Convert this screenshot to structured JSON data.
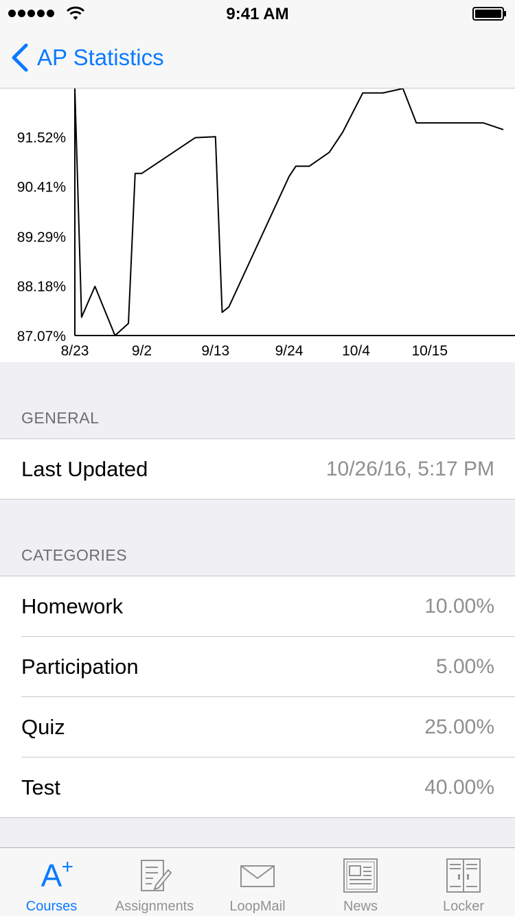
{
  "status_bar": {
    "time": "9:41 AM"
  },
  "nav": {
    "back_label": "AP Statistics"
  },
  "chart_data": {
    "type": "line",
    "x_tick_labels": [
      "8/23",
      "9/2",
      "9/13",
      "9/24",
      "10/4",
      "10/15"
    ],
    "y_tick_labels": [
      "87.07%",
      "88.18%",
      "89.29%",
      "90.41%",
      "91.52%"
    ],
    "ylim": [
      87.07,
      92.6
    ],
    "series": [
      {
        "x": [
          "8/23",
          "8/24",
          "8/26",
          "8/29",
          "8/31",
          "9/1",
          "9/2",
          "9/10",
          "9/13",
          "9/14",
          "9/15",
          "9/24",
          "9/25",
          "9/27",
          "9/30",
          "10/2",
          "10/5",
          "10/8",
          "10/11",
          "10/13",
          "10/17",
          "10/19",
          "10/23",
          "10/26"
        ],
        "y": [
          92.6,
          87.48,
          88.17,
          87.07,
          87.34,
          90.7,
          90.7,
          91.5,
          91.52,
          87.59,
          87.71,
          90.63,
          90.86,
          90.86,
          91.17,
          91.62,
          92.5,
          92.5,
          92.6,
          91.83,
          91.83,
          91.83,
          91.83,
          91.68
        ],
        "color": "#000000"
      }
    ]
  },
  "general": {
    "header": "GENERAL",
    "rows": [
      {
        "label": "Last Updated",
        "value": "10/26/16, 5:17 PM"
      }
    ]
  },
  "categories": {
    "header": "CATEGORIES",
    "rows": [
      {
        "label": "Homework",
        "value": "10.00%"
      },
      {
        "label": "Participation",
        "value": "5.00%"
      },
      {
        "label": "Quiz",
        "value": "25.00%"
      },
      {
        "label": "Test",
        "value": "40.00%"
      }
    ]
  },
  "tabs": [
    {
      "label": "Courses",
      "icon": "a-plus-icon",
      "active": true
    },
    {
      "label": "Assignments",
      "icon": "assignments-icon",
      "active": false
    },
    {
      "label": "LoopMail",
      "icon": "mail-icon",
      "active": false
    },
    {
      "label": "News",
      "icon": "news-icon",
      "active": false
    },
    {
      "label": "Locker",
      "icon": "locker-icon",
      "active": false
    }
  ],
  "colors": {
    "accent": "#0a7aff",
    "secondary_text": "#8e8e93"
  }
}
